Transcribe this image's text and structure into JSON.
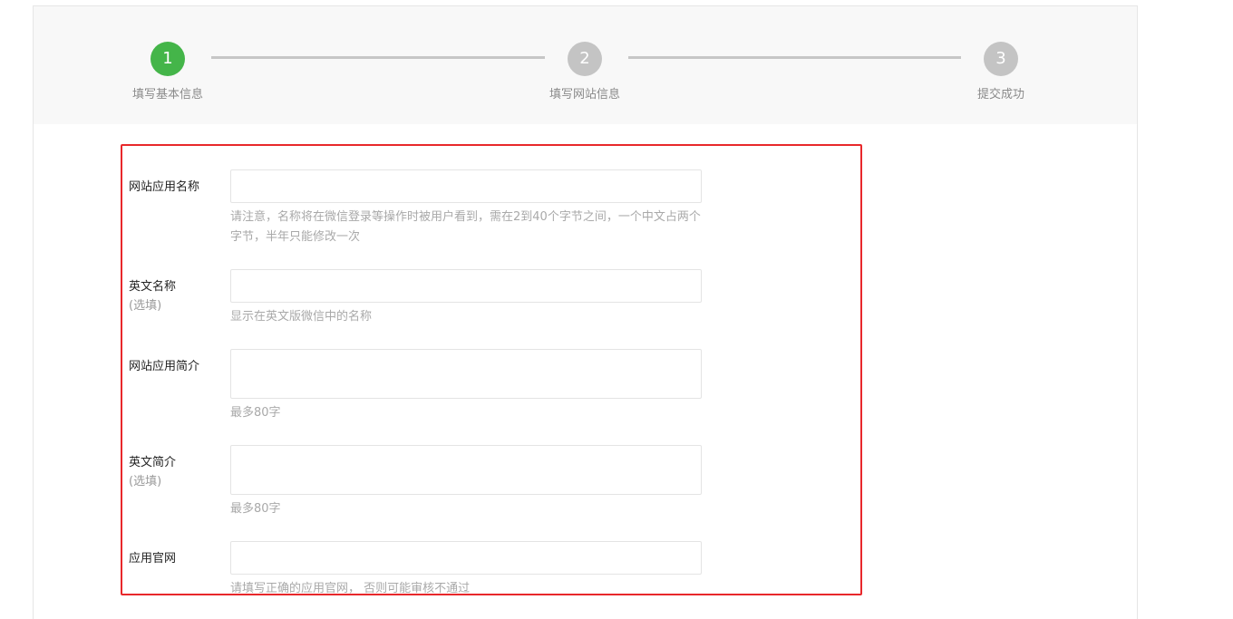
{
  "steps": [
    {
      "number": "1",
      "label": "填写基本信息",
      "state": "active"
    },
    {
      "number": "2",
      "label": "填写网站信息",
      "state": "pending"
    },
    {
      "number": "3",
      "label": "提交成功",
      "state": "pending"
    }
  ],
  "colors": {
    "active_step": "#44b549",
    "pending_step": "#c4c4c4",
    "highlight_border": "#e8282b"
  },
  "form": {
    "app_name": {
      "label": "网站应用名称",
      "value": "",
      "hint": "请注意，名称将在微信登录等操作时被用户看到，需在2到40个字节之间，一个中文占两个字节，半年只能修改一次"
    },
    "english_name": {
      "label": "英文名称",
      "optional": "(选填)",
      "value": "",
      "hint": "显示在英文版微信中的名称"
    },
    "app_intro": {
      "label": "网站应用简介",
      "value": "",
      "hint": "最多80字"
    },
    "english_intro": {
      "label": "英文简介",
      "optional": "(选填)",
      "value": "",
      "hint": "最多80字"
    },
    "website": {
      "label": "应用官网",
      "value": "",
      "hint": "请填写正确的应用官网， 否则可能审核不通过"
    }
  }
}
